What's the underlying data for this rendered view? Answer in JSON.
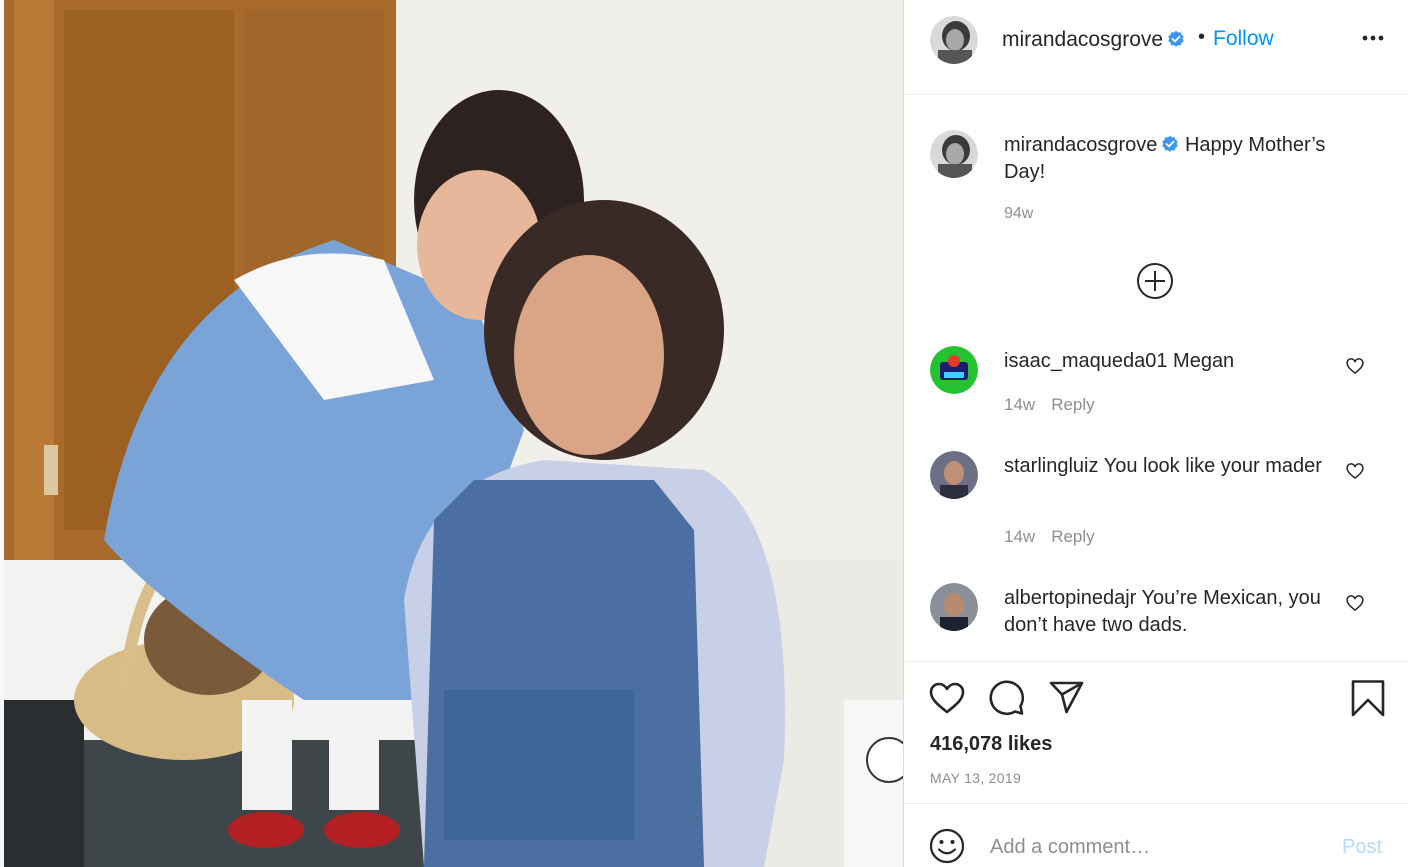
{
  "post": {
    "image_alt": "",
    "author": "mirandacosgrove",
    "verified": true,
    "separator": "•",
    "follow_label": "Follow",
    "more_icon": "more-options-icon"
  },
  "caption": {
    "username": "mirandacosgrove",
    "text": "Happy Mother’s Day!",
    "age": "94w"
  },
  "load_more_icon": "plus-circle-icon",
  "comments": [
    {
      "username": "isaac_maqueda01",
      "text": "Megan",
      "age": "14w",
      "reply_label": "Reply",
      "avatar_color": "#26c233"
    },
    {
      "username": "starlingluiz",
      "text": "You look like your mader",
      "age": "14w",
      "reply_label": "Reply",
      "avatar_color": "#4a4a58"
    },
    {
      "username": "albertopinedajr",
      "text": "You’re Mexican, you don’t have two dads.",
      "age": "",
      "reply_label": "",
      "avatar_color": "#5a5f6a"
    }
  ],
  "actions": {
    "like_icon": "heart-icon",
    "comment_icon": "comment-icon",
    "share_icon": "send-icon",
    "save_icon": "bookmark-icon"
  },
  "likes": "416,078 likes",
  "date": "MAY 13, 2019",
  "add_comment": {
    "placeholder": "Add a comment…",
    "post_label": "Post",
    "emoji_icon": "emoji-icon"
  },
  "colors": {
    "link_blue": "#0095f6",
    "post_disabled": "#b3dbff",
    "muted": "#8e8e8e",
    "text": "#262626"
  }
}
